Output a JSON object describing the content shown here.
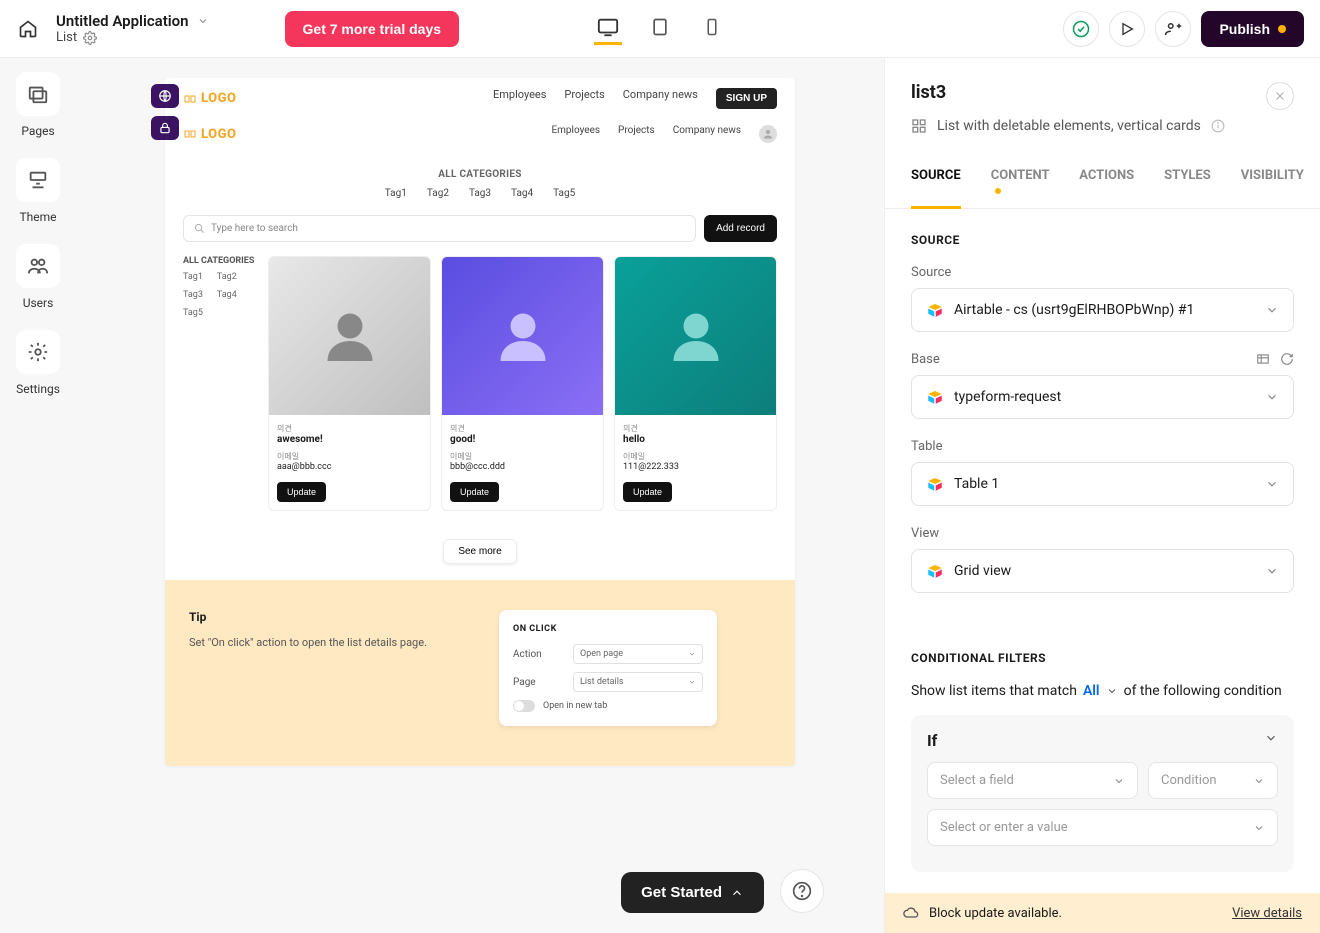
{
  "topbar": {
    "app_title": "Untitled Application",
    "page_name": "List",
    "trial_button": "Get 7 more trial days",
    "publish_button": "Publish"
  },
  "leftbar": {
    "pages": "Pages",
    "theme": "Theme",
    "users": "Users",
    "settings": "Settings"
  },
  "canvas": {
    "logo": "LOGO",
    "nav": {
      "employees": "Employees",
      "projects": "Projects",
      "news": "Company news",
      "signup": "SIGN UP"
    },
    "all_categories": "ALL CATEGORIES",
    "tags": [
      "Tag1",
      "Tag2",
      "Tag3",
      "Tag4",
      "Tag5"
    ],
    "search_placeholder": "Type here to search",
    "add_record": "Add record",
    "side_head": "ALL CATEGORIES",
    "side_tags": [
      "Tag1",
      "Tag2",
      "Tag3",
      "Tag4",
      "Tag5"
    ],
    "cards": [
      {
        "opinion_label": "의견",
        "opinion": "awesome!",
        "email_label": "이메일",
        "email": "aaa@bbb.ccc",
        "update": "Update"
      },
      {
        "opinion_label": "의견",
        "opinion": "good!",
        "email_label": "이메일",
        "email": "bbb@ccc.ddd",
        "update": "Update"
      },
      {
        "opinion_label": "의견",
        "opinion": "hello",
        "email_label": "이메일",
        "email": "111@222.333",
        "update": "Update"
      }
    ],
    "see_more": "See more",
    "tip": {
      "heading": "Tip",
      "text": "Set \"On click\" action to open the list details page.",
      "card_title": "ON CLICK",
      "action_label": "Action",
      "action_value": "Open page",
      "page_label": "Page",
      "page_value": "List details",
      "open_new_tab": "Open in new tab"
    }
  },
  "right": {
    "title": "list3",
    "subtitle": "List with deletable elements, vertical cards",
    "tabs": {
      "source": "SOURCE",
      "content": "CONTENT",
      "actions": "ACTIONS",
      "styles": "STYLES",
      "visibility": "VISIBILITY"
    },
    "source_head": "SOURCE",
    "source_label": "Source",
    "source_value": "Airtable - cs (usrt9gElRHBOPbWnp) #1",
    "base_label": "Base",
    "base_value": "typeform-request",
    "table_label": "Table",
    "table_value": "Table 1",
    "view_label": "View",
    "view_value": "Grid view",
    "cond_head": "CONDITIONAL FILTERS",
    "cond_pre": "Show list items that match",
    "cond_all": "All",
    "cond_post": "of the following condition",
    "if": "If",
    "select_field": "Select a field",
    "condition": "Condition",
    "select_value": "Select or enter a value",
    "update_msg": "Block update available.",
    "view_details": "View details"
  },
  "floating": {
    "get_started": "Get Started"
  }
}
